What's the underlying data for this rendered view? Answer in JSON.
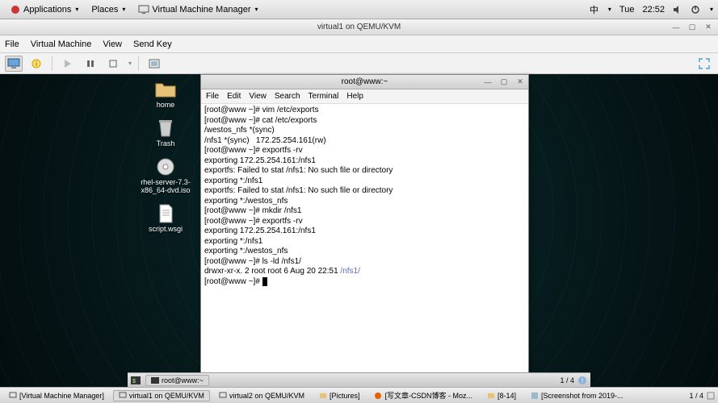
{
  "top_panel": {
    "applications": "Applications",
    "places": "Places",
    "vmm": "Virtual Machine Manager",
    "lang": "中",
    "day": "Tue",
    "time": "22:52"
  },
  "vm_window": {
    "title": "virtual1 on QEMU/KVM",
    "menu": {
      "file": "File",
      "vm": "Virtual Machine",
      "view": "View",
      "sendkey": "Send Key"
    }
  },
  "desktop": {
    "home": "home",
    "trash": "Trash",
    "iso": "rhel-server-7.3-x86_64-dvd.iso",
    "script": "script.wsgi"
  },
  "terminal": {
    "title": "root@www:~",
    "menu": {
      "file": "File",
      "edit": "Edit",
      "view": "View",
      "search": "Search",
      "terminal": "Terminal",
      "help": "Help"
    },
    "lines": {
      "l1": "[root@www ~]# vim /etc/exports",
      "l2": "[root@www ~]# cat /etc/exports",
      "l3": "/westos_nfs *(sync)",
      "l4": "/nfs1 *(sync)   172.25.254.161(rw)",
      "l5": "[root@www ~]# exportfs -rv",
      "l6": "exporting 172.25.254.161:/nfs1",
      "l7": "exportfs: Failed to stat /nfs1: No such file or directory",
      "l8": "exporting *:/nfs1",
      "l9": "exportfs: Failed to stat /nfs1: No such file or directory",
      "l10": "exporting *:/westos_nfs",
      "l11": "[root@www ~]# mkdir /nfs1",
      "l12": "[root@www ~]# exportfs -rv",
      "l13": "exporting 172.25.254.161:/nfs1",
      "l14": "exporting *:/nfs1",
      "l15": "exporting *:/westos_nfs",
      "l16": "[root@www ~]# ls -ld /nfs1/",
      "l17a": "drwxr-xr-x. 2 root root 6 Aug 20 22:51 ",
      "l17b": "/nfs1/",
      "l18": "[root@www ~]# "
    }
  },
  "guest_taskbar": {
    "task1": "root@www:~",
    "ws": "1 / 4"
  },
  "host_taskbar": {
    "t1": "[Virtual Machine Manager]",
    "t2": "virtual1 on QEMU/KVM",
    "t3": "virtual2 on QEMU/KVM",
    "t4": "[Pictures]",
    "t5": "[写文章-CSDN博客 - Moz...",
    "t6": "[8-14]",
    "t7": "[Screenshot from 2019-...",
    "ws": "1 / 4"
  }
}
